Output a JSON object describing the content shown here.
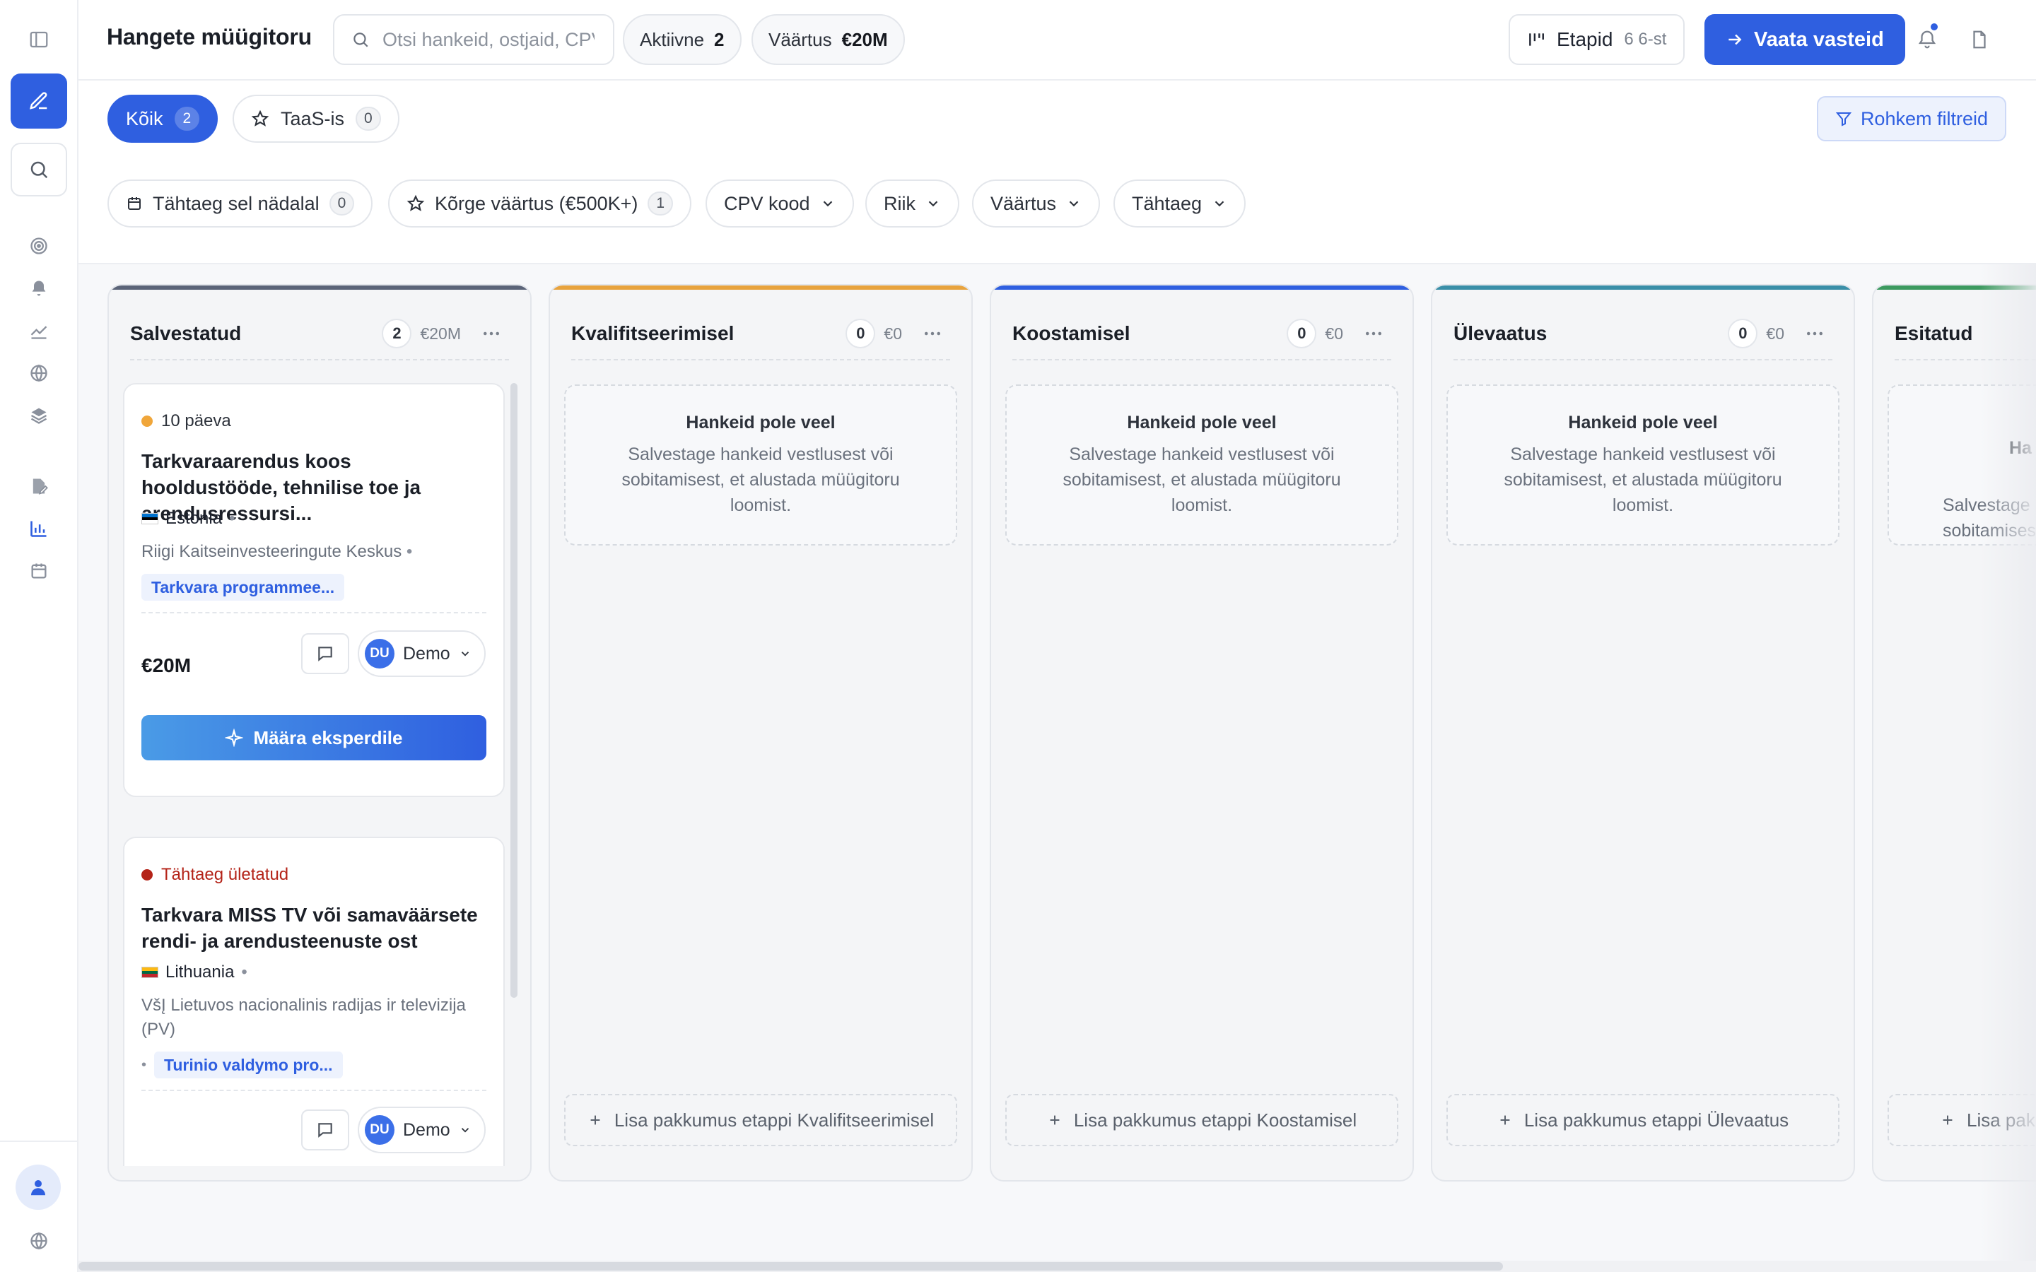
{
  "header": {
    "title": "Hangete müügitoru",
    "search_placeholder": "Otsi hankeid, ostjaid, CPV",
    "active_label": "Aktiivne",
    "active_count": "2",
    "value_label": "Väärtus",
    "value_amount": "€20M",
    "stages_label": "Etapid",
    "stages_count": "6 6-st",
    "view_responses": "Vaata vasteid"
  },
  "tabs": [
    {
      "label": "Kõik",
      "count": "2",
      "active": true
    },
    {
      "label": "TaaS-is",
      "count": "0",
      "active": false
    }
  ],
  "more_filters": "Rohkem filtreid",
  "filter_chips": [
    {
      "label": "Tähtaeg sel nädalal",
      "count": "0"
    },
    {
      "label": "Kõrge väärtus (€500K+)",
      "count": "1"
    },
    {
      "label": "CPV kood"
    },
    {
      "label": "Riik"
    },
    {
      "label": "Väärtus"
    },
    {
      "label": "Tähtaeg"
    }
  ],
  "columns": [
    {
      "title": "Salvestatud",
      "count": "2",
      "value": "€20M",
      "accent": "#5b6478"
    },
    {
      "title": "Kvalifitseerimisel",
      "count": "0",
      "value": "€0",
      "accent": "#e8a33d",
      "empty_title": "Hankeid pole veel",
      "empty_desc": "Salvestage hankeid vestlusest või sobitamisest, et alustada müügitoru loomist.",
      "add": "Lisa pakkumus etappi Kvalifitseerimisel"
    },
    {
      "title": "Koostamisel",
      "count": "0",
      "value": "€0",
      "accent": "#2f5fe0",
      "empty_title": "Hankeid pole veel",
      "empty_desc": "Salvestage hankeid vestlusest või sobitamisest, et alustada müügitoru loomist.",
      "add": "Lisa pakkumus etappi Koostamisel"
    },
    {
      "title": "Ülevaatus",
      "count": "0",
      "value": "€0",
      "accent": "#3a8fa8",
      "empty_title": "Hankeid pole veel",
      "empty_desc": "Salvestage hankeid vestlusest või sobitamisest, et alustada müügitoru loomist.",
      "add": "Lisa pakkumus etappi Ülevaatus"
    },
    {
      "title": "Esitatud",
      "accent": "#3c9a5f",
      "empty_title": "Ha",
      "empty_desc": "Salvestage\nsobitamises",
      "add": "Lisa pak"
    }
  ],
  "cards": [
    {
      "deadline": "10 päeva",
      "deadline_color": "#f0a63a",
      "title": "Tarkvaraarendus koos hooldustööde, tehnilise toe ja arendusressursi...",
      "country": "Estonia",
      "buyer": "Riigi Kaitseinvesteeringute Keskus",
      "tag": "Tarkvara programmee...",
      "price": "€20M",
      "assignee_initials": "DU",
      "assignee_name": "Demo",
      "action": "Määra eksperdile"
    },
    {
      "deadline": "Tähtaeg ületatud",
      "deadline_color": "#b42318",
      "title": "Tarkvara MISS TV või samaväärsete rendi- ja arendusteenuste ost",
      "country": "Lithuania",
      "buyer": "VšĮ Lietuvos nacionalinis radijas ir televizija (PV)",
      "tag": "Turinio valdymo pro...",
      "assignee_initials": "DU",
      "assignee_name": "Demo"
    }
  ]
}
